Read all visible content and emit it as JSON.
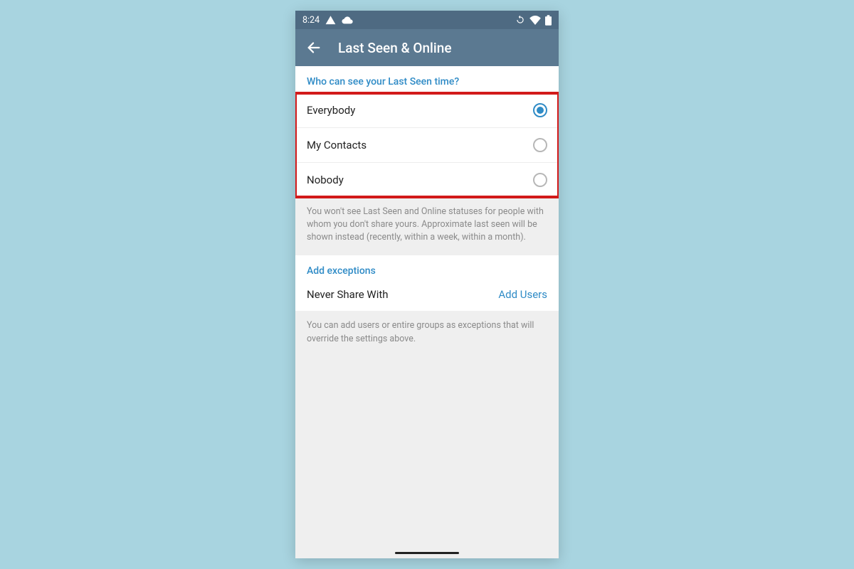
{
  "status": {
    "time": "8:24"
  },
  "appbar": {
    "title": "Last Seen & Online"
  },
  "section1": {
    "header": "Who can see your Last Seen time?",
    "options": [
      {
        "label": "Everybody",
        "selected": true
      },
      {
        "label": "My Contacts",
        "selected": false
      },
      {
        "label": "Nobody",
        "selected": false
      }
    ],
    "info": "You won't see Last Seen and Online statuses for people with whom you don't share yours. Approximate last seen will be shown instead (recently, within a week, within a month)."
  },
  "section2": {
    "header": "Add exceptions",
    "row": {
      "label": "Never Share With",
      "action": "Add Users"
    },
    "info": "You can add users or entire groups as exceptions that will override the settings above."
  },
  "colors": {
    "accent": "#2f8bc6",
    "appbar": "#5b7991",
    "statusbar": "#4e6a82",
    "highlight": "#d21a1a"
  }
}
